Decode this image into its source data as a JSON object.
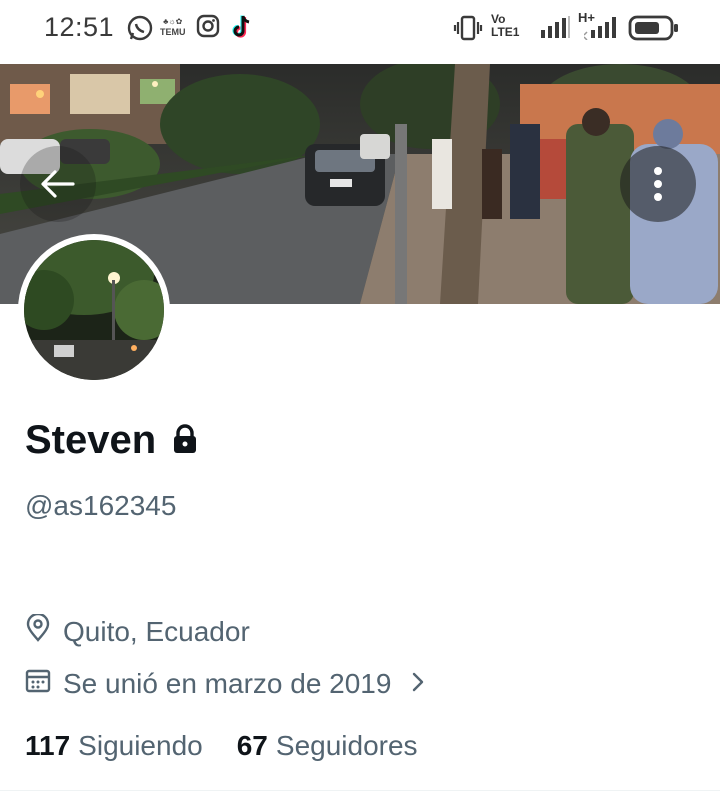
{
  "status_bar": {
    "time": "12:51",
    "temu_label": "TEMU",
    "volte_top": "Vo",
    "volte_bottom": "LTE1",
    "network_type": "H+",
    "icons": [
      "whatsapp-icon",
      "temu-icon",
      "instagram-icon",
      "tiktok-icon",
      "vibrate-icon",
      "signal-icon",
      "battery-icon"
    ]
  },
  "header": {
    "back_icon": "arrow-left-icon",
    "more_icon": "more-vertical-icon"
  },
  "profile": {
    "name": "Steven",
    "protected_icon": "lock-icon",
    "handle": "@as162345",
    "location": "Quito, Ecuador",
    "joined": "Se unió en marzo de 2019",
    "following_count": "117",
    "following_label": "Siguiendo",
    "followers_count": "67",
    "followers_label": "Seguidores"
  },
  "colors": {
    "text_primary": "#0f1419",
    "text_secondary": "#536471"
  }
}
